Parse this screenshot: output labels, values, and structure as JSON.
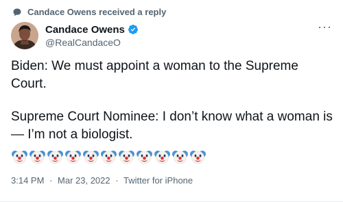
{
  "social_context": {
    "icon": "speech-bubble-icon",
    "text": "Candace Owens received a reply"
  },
  "author": {
    "display_name": "Candace Owens",
    "handle": "@RealCandaceO",
    "verified_icon": "verified-badge-icon",
    "avatar_icon": "profile-photo"
  },
  "more_label": "···",
  "tweet": {
    "paragraph_1": "Biden: We must appoint a woman to the Supreme Court.",
    "paragraph_2": "Supreme Court Nominee: I don’t know what a woman is— I’m not a biologist.",
    "emoji": "🤡",
    "emoji_count": 11
  },
  "meta": {
    "time": "3:14 PM",
    "date": "Mar 23, 2022",
    "source": "Twitter for iPhone",
    "separator": "·"
  },
  "colors": {
    "text": "#0f1419",
    "secondary": "#536471",
    "verified": "#1d9bf0"
  }
}
